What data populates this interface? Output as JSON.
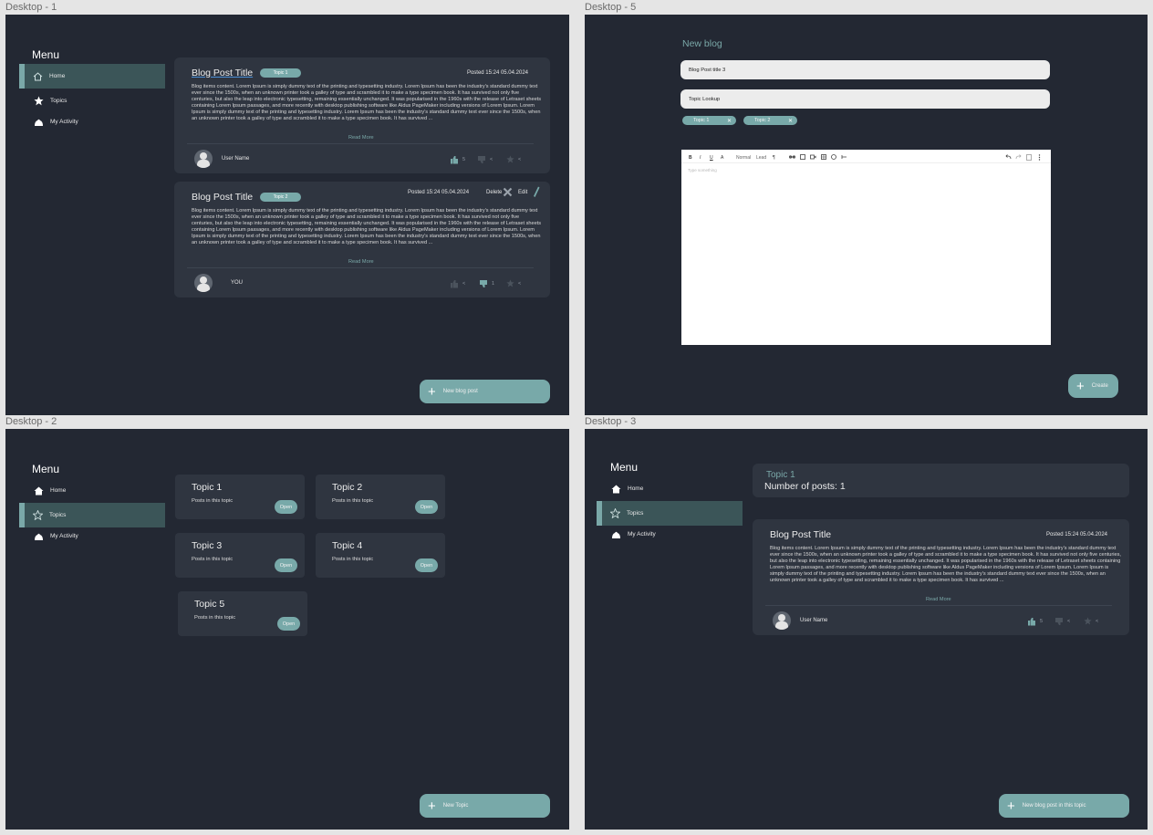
{
  "frames": {
    "d1": "Desktop - 1",
    "d5": "Desktop - 5",
    "d2": "Desktop - 2",
    "d3": "Desktop - 3"
  },
  "menu": {
    "title": "Menu",
    "home": "Home",
    "topics": "Topics",
    "activity": "My Activity"
  },
  "post_text": "Blog items content. Lorem Ipsum is simply dummy text of the printing and typesetting industry. Lorem Ipsum has been the industry's standard dummy text ever since the 1500s, when an unknown printer took a galley of type and scrambled it to make a type specimen book. It has survived not only five centuries, but also the leap into electronic typesetting, remaining essentially unchanged. It was popularised in the 1960s with the release of Letraset sheets containing Lorem Ipsum passages, and more recently with desktop publishing software like Aldus PageMaker including versions of Lorem Ipsum. Lorem Ipsum is simply dummy text of the printing and typesetting industry. Lorem Ipsum has been the industry's standard dummy text ever since the 1500s, when an unknown printer took a galley of type and scrambled it to make a type specimen book. It has survived ...",
  "read_more": "Read More",
  "d1": {
    "post1": {
      "title": "Blog Post Title",
      "topic": "Topic 1",
      "posted": "Posted 15:24 05.04.2024",
      "user": "User Name",
      "likes": "5",
      "dislikes": "",
      "stars": ""
    },
    "post2": {
      "title": "Blog Post Title",
      "topic": "Topic 2",
      "posted": "Posted 15:24 05.04.2024",
      "delete": "Delete",
      "edit": "Edit",
      "user": "YOU",
      "likes": "",
      "dislikes": "1",
      "stars": ""
    },
    "fab": "New blog post"
  },
  "d5": {
    "heading": "New blog",
    "title_value": "Blog Post title 3",
    "topic_placeholder": "Topic Lookup",
    "chips": [
      "Topic 1",
      "Topic 2"
    ],
    "toolbar": {
      "bold": "B",
      "italic": "I",
      "underline": "U",
      "font_size": "A",
      "format": "Normal",
      "lead": "Lead",
      "heading": "¶"
    },
    "editor_placeholder": "Type something",
    "create": "Create"
  },
  "d2": {
    "topics": [
      {
        "name": "Topic 1",
        "sub": "Posts in this topic",
        "open": "Open"
      },
      {
        "name": "Topic 2",
        "sub": "Posts in this topic",
        "open": "Open"
      },
      {
        "name": "Topic 3",
        "sub": "Posts in this topic",
        "open": "Open"
      },
      {
        "name": "Topic 4",
        "sub": "Posts in this topic",
        "open": "Open"
      },
      {
        "name": "Topic 5",
        "sub": "Posts in this topic",
        "open": "Open"
      }
    ],
    "fab": "New Topic"
  },
  "d3": {
    "topic_name": "Topic 1",
    "post_count": "Number of posts: 1",
    "post": {
      "title": "Blog Post Title",
      "posted": "Posted 15:24 05.04.2024",
      "user": "User Name",
      "likes": "5",
      "dislikes": "",
      "stars": ""
    },
    "fab": "New blog post in this topic"
  },
  "colors": {
    "frame_bg": "#232833",
    "card_bg": "#2f3540",
    "accent": "#78a9a9",
    "active_nav": "#3b5558"
  }
}
